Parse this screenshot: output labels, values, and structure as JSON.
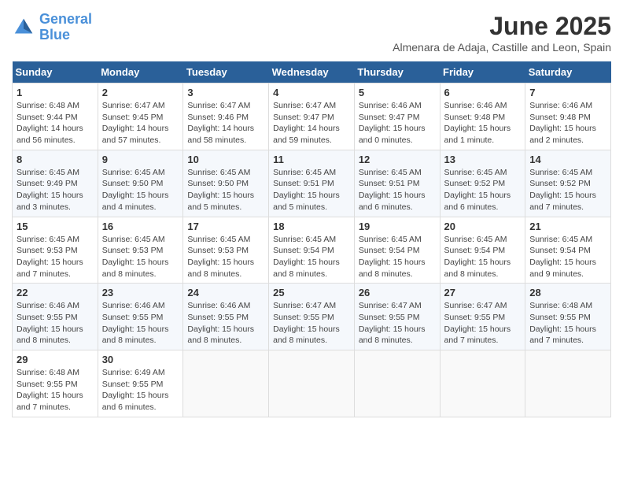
{
  "logo": {
    "line1": "General",
    "line2": "Blue"
  },
  "title": "June 2025",
  "subtitle": "Almenara de Adaja, Castille and Leon, Spain",
  "days_of_week": [
    "Sunday",
    "Monday",
    "Tuesday",
    "Wednesday",
    "Thursday",
    "Friday",
    "Saturday"
  ],
  "weeks": [
    [
      {
        "day": "1",
        "info": "Sunrise: 6:48 AM\nSunset: 9:44 PM\nDaylight: 14 hours\nand 56 minutes."
      },
      {
        "day": "2",
        "info": "Sunrise: 6:47 AM\nSunset: 9:45 PM\nDaylight: 14 hours\nand 57 minutes."
      },
      {
        "day": "3",
        "info": "Sunrise: 6:47 AM\nSunset: 9:46 PM\nDaylight: 14 hours\nand 58 minutes."
      },
      {
        "day": "4",
        "info": "Sunrise: 6:47 AM\nSunset: 9:47 PM\nDaylight: 14 hours\nand 59 minutes."
      },
      {
        "day": "5",
        "info": "Sunrise: 6:46 AM\nSunset: 9:47 PM\nDaylight: 15 hours\nand 0 minutes."
      },
      {
        "day": "6",
        "info": "Sunrise: 6:46 AM\nSunset: 9:48 PM\nDaylight: 15 hours\nand 1 minute."
      },
      {
        "day": "7",
        "info": "Sunrise: 6:46 AM\nSunset: 9:48 PM\nDaylight: 15 hours\nand 2 minutes."
      }
    ],
    [
      {
        "day": "8",
        "info": "Sunrise: 6:45 AM\nSunset: 9:49 PM\nDaylight: 15 hours\nand 3 minutes."
      },
      {
        "day": "9",
        "info": "Sunrise: 6:45 AM\nSunset: 9:50 PM\nDaylight: 15 hours\nand 4 minutes."
      },
      {
        "day": "10",
        "info": "Sunrise: 6:45 AM\nSunset: 9:50 PM\nDaylight: 15 hours\nand 5 minutes."
      },
      {
        "day": "11",
        "info": "Sunrise: 6:45 AM\nSunset: 9:51 PM\nDaylight: 15 hours\nand 5 minutes."
      },
      {
        "day": "12",
        "info": "Sunrise: 6:45 AM\nSunset: 9:51 PM\nDaylight: 15 hours\nand 6 minutes."
      },
      {
        "day": "13",
        "info": "Sunrise: 6:45 AM\nSunset: 9:52 PM\nDaylight: 15 hours\nand 6 minutes."
      },
      {
        "day": "14",
        "info": "Sunrise: 6:45 AM\nSunset: 9:52 PM\nDaylight: 15 hours\nand 7 minutes."
      }
    ],
    [
      {
        "day": "15",
        "info": "Sunrise: 6:45 AM\nSunset: 9:53 PM\nDaylight: 15 hours\nand 7 minutes."
      },
      {
        "day": "16",
        "info": "Sunrise: 6:45 AM\nSunset: 9:53 PM\nDaylight: 15 hours\nand 8 minutes."
      },
      {
        "day": "17",
        "info": "Sunrise: 6:45 AM\nSunset: 9:53 PM\nDaylight: 15 hours\nand 8 minutes."
      },
      {
        "day": "18",
        "info": "Sunrise: 6:45 AM\nSunset: 9:54 PM\nDaylight: 15 hours\nand 8 minutes."
      },
      {
        "day": "19",
        "info": "Sunrise: 6:45 AM\nSunset: 9:54 PM\nDaylight: 15 hours\nand 8 minutes."
      },
      {
        "day": "20",
        "info": "Sunrise: 6:45 AM\nSunset: 9:54 PM\nDaylight: 15 hours\nand 8 minutes."
      },
      {
        "day": "21",
        "info": "Sunrise: 6:45 AM\nSunset: 9:54 PM\nDaylight: 15 hours\nand 9 minutes."
      }
    ],
    [
      {
        "day": "22",
        "info": "Sunrise: 6:46 AM\nSunset: 9:55 PM\nDaylight: 15 hours\nand 8 minutes."
      },
      {
        "day": "23",
        "info": "Sunrise: 6:46 AM\nSunset: 9:55 PM\nDaylight: 15 hours\nand 8 minutes."
      },
      {
        "day": "24",
        "info": "Sunrise: 6:46 AM\nSunset: 9:55 PM\nDaylight: 15 hours\nand 8 minutes."
      },
      {
        "day": "25",
        "info": "Sunrise: 6:47 AM\nSunset: 9:55 PM\nDaylight: 15 hours\nand 8 minutes."
      },
      {
        "day": "26",
        "info": "Sunrise: 6:47 AM\nSunset: 9:55 PM\nDaylight: 15 hours\nand 8 minutes."
      },
      {
        "day": "27",
        "info": "Sunrise: 6:47 AM\nSunset: 9:55 PM\nDaylight: 15 hours\nand 7 minutes."
      },
      {
        "day": "28",
        "info": "Sunrise: 6:48 AM\nSunset: 9:55 PM\nDaylight: 15 hours\nand 7 minutes."
      }
    ],
    [
      {
        "day": "29",
        "info": "Sunrise: 6:48 AM\nSunset: 9:55 PM\nDaylight: 15 hours\nand 7 minutes."
      },
      {
        "day": "30",
        "info": "Sunrise: 6:49 AM\nSunset: 9:55 PM\nDaylight: 15 hours\nand 6 minutes."
      },
      {
        "day": "",
        "info": ""
      },
      {
        "day": "",
        "info": ""
      },
      {
        "day": "",
        "info": ""
      },
      {
        "day": "",
        "info": ""
      },
      {
        "day": "",
        "info": ""
      }
    ]
  ]
}
